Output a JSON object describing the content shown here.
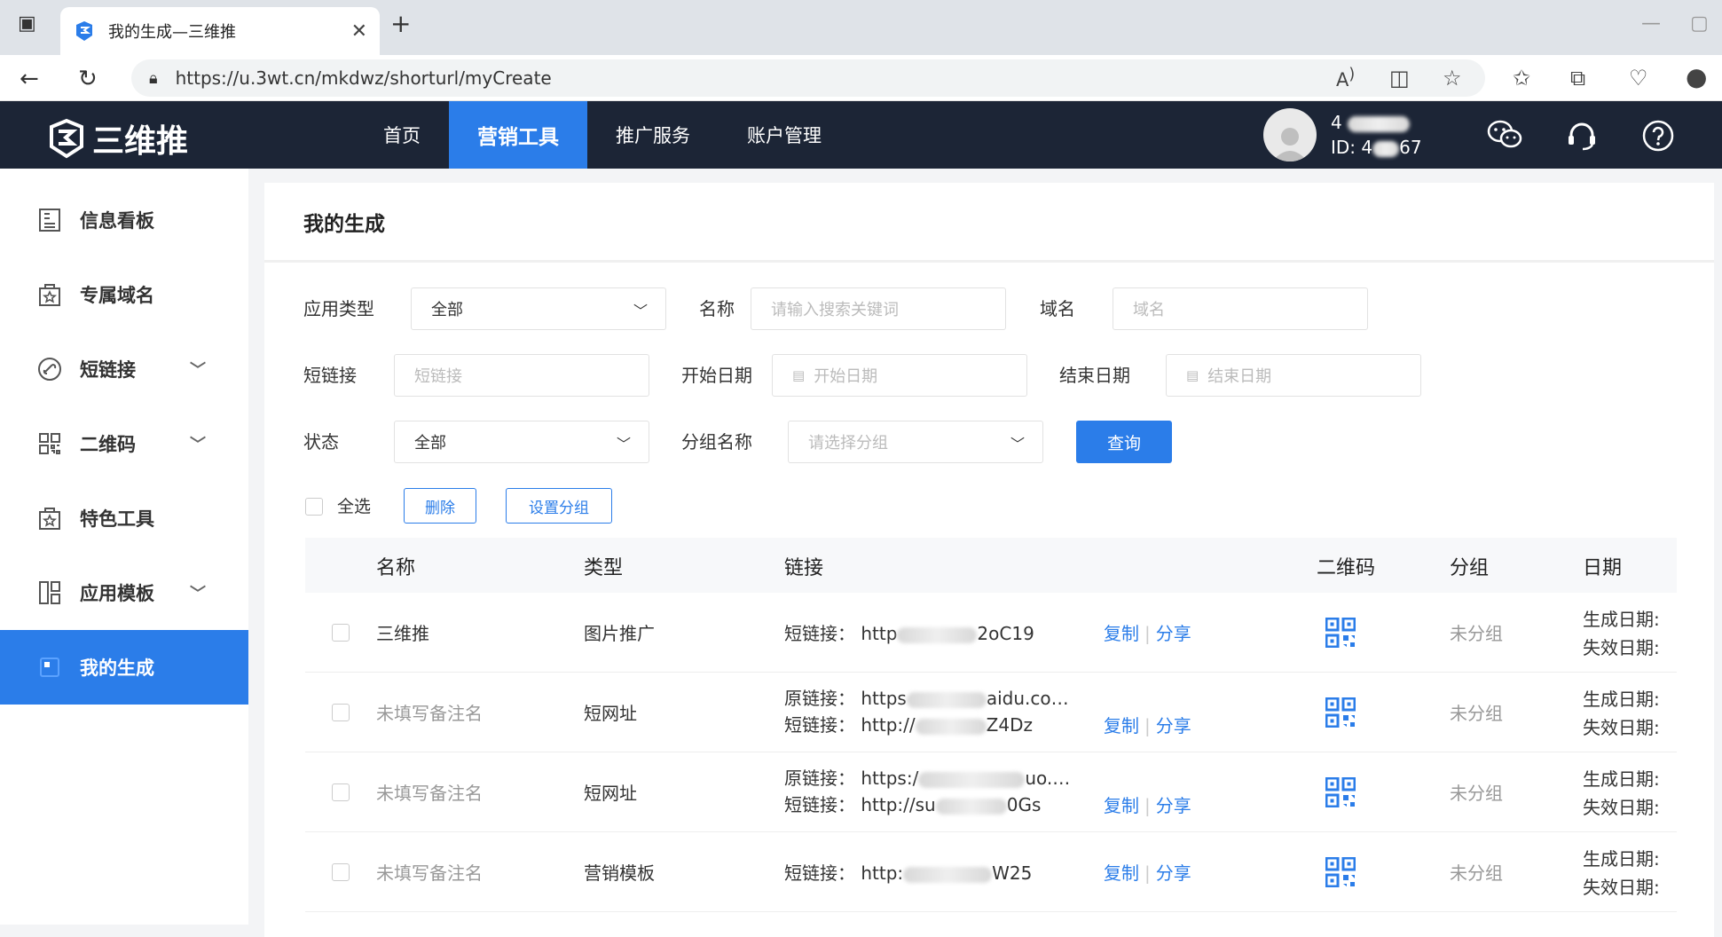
{
  "browser": {
    "tab_title": "我的生成—三维推",
    "url": "https://u.3wt.cn/mkdwz/shorturl/myCreate"
  },
  "header": {
    "logo_text": "三维推",
    "nav": [
      "首页",
      "营销工具",
      "推广服务",
      "账户管理"
    ],
    "active_nav": "营销工具",
    "user_name_partial": "4",
    "user_id_prefix": "ID: 4",
    "user_id_suffix": "67"
  },
  "sidebar": {
    "items": [
      {
        "label": "信息看板",
        "icon": "dashboard-icon",
        "expandable": false
      },
      {
        "label": "专属域名",
        "icon": "star-bag-icon",
        "expandable": false
      },
      {
        "label": "短链接",
        "icon": "link-icon",
        "expandable": true
      },
      {
        "label": "二维码",
        "icon": "qrcode-icon",
        "expandable": true
      },
      {
        "label": "特色工具",
        "icon": "star-bag-icon",
        "expandable": false
      },
      {
        "label": "应用模板",
        "icon": "template-icon",
        "expandable": true
      },
      {
        "label": "我的生成",
        "icon": "my-create-icon",
        "expandable": false,
        "active": true
      }
    ]
  },
  "page": {
    "title": "我的生成",
    "filters": {
      "app_type_label": "应用类型",
      "app_type_value": "全部",
      "name_label": "名称",
      "name_placeholder": "请输入搜索关键词",
      "domain_label": "域名",
      "domain_placeholder": "域名",
      "short_label": "短链接",
      "short_placeholder": "短链接",
      "start_label": "开始日期",
      "start_placeholder": "开始日期",
      "end_label": "结束日期",
      "end_placeholder": "结束日期",
      "status_label": "状态",
      "status_value": "全部",
      "group_label": "分组名称",
      "group_placeholder": "请选择分组",
      "query_button": "查询"
    },
    "bulk": {
      "select_all": "全选",
      "delete": "删除",
      "set_group": "设置分组"
    },
    "table": {
      "headers": [
        "名称",
        "类型",
        "链接",
        "二维码",
        "分组",
        "日期"
      ],
      "copy": "复制",
      "share": "分享",
      "orig_label": "原链接：",
      "short_label": "短链接：",
      "created_label": "生成日期:",
      "expire_label": "失效日期:",
      "rows": [
        {
          "name": "三维推",
          "name_muted": false,
          "type": "图片推广",
          "orig_prefix": "",
          "orig_suffix": "",
          "short_prefix": "http",
          "short_suffix": "2oC19",
          "group": "未分组"
        },
        {
          "name": "未填写备注名",
          "name_muted": true,
          "type": "短网址",
          "orig_prefix": "https",
          "orig_suffix": "aidu.co…",
          "short_prefix": "http://",
          "short_suffix": "Z4Dz",
          "group": "未分组"
        },
        {
          "name": "未填写备注名",
          "name_muted": true,
          "type": "短网址",
          "orig_prefix": "https:/",
          "orig_suffix": "uo.…",
          "short_prefix": "http://su",
          "short_suffix": "0Gs",
          "group": "未分组"
        },
        {
          "name": "未填写备注名",
          "name_muted": true,
          "type": "营销模板",
          "orig_prefix": "",
          "orig_suffix": "",
          "short_prefix": "http:",
          "short_suffix": "W25",
          "group": "未分组"
        }
      ]
    }
  },
  "colors": {
    "header_bg": "#1c2536",
    "accent": "#2b7de9"
  }
}
